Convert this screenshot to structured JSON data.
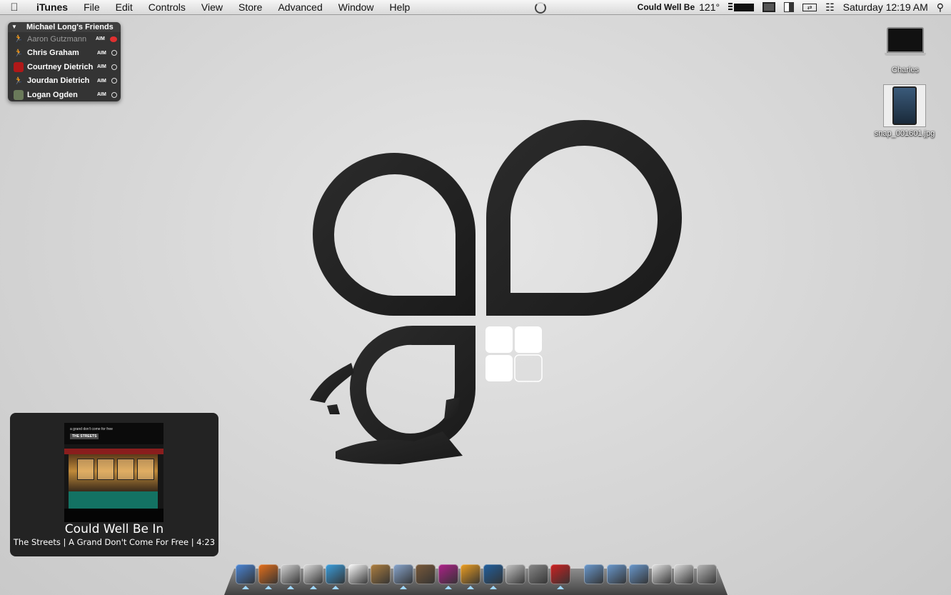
{
  "menubar": {
    "app": "iTunes",
    "menus": [
      "File",
      "Edit",
      "Controls",
      "View",
      "Store",
      "Advanced",
      "Window",
      "Help"
    ],
    "now_playing": "Could Well Be",
    "temperature": "121°",
    "clock": "Saturday 12:19 AM"
  },
  "buddy_list": {
    "title": "Michael Long's Friends",
    "buddies": [
      {
        "name": "Aaron Gutzmann",
        "service": "AIM",
        "status": "away"
      },
      {
        "name": "Chris Graham",
        "service": "AIM",
        "status": "available"
      },
      {
        "name": "Courtney Dietrich",
        "service": "AIM",
        "status": "available"
      },
      {
        "name": "Jourdan Dietrich",
        "service": "AIM",
        "status": "available"
      },
      {
        "name": "Logan Ogden",
        "service": "AIM",
        "status": "available"
      }
    ]
  },
  "desktop": {
    "icons": [
      {
        "label": "Charles",
        "kind": "laptop-icon"
      },
      {
        "label": "snap_001601.jpg",
        "kind": "image-file-icon"
      }
    ]
  },
  "growl": {
    "title": "Could Well Be In",
    "detail": "The Streets | A Grand Don't Come For Free | 4:23",
    "album_art": {
      "top_text": "a grand don't come for free",
      "artist_tag": "THE STREETS"
    }
  },
  "dock": {
    "apps": [
      {
        "name": "finder-icon",
        "running": true,
        "color": "#4a86d8"
      },
      {
        "name": "firefox-icon",
        "running": true,
        "color": "#e8701a"
      },
      {
        "name": "mail-icon",
        "running": true,
        "color": "#d8d8d8"
      },
      {
        "name": "ichat-icon",
        "running": true,
        "color": "#e0e0e0"
      },
      {
        "name": "itunes-icon",
        "running": true,
        "color": "#3aa0e0"
      },
      {
        "name": "ical-icon",
        "running": false,
        "color": "#ffffff"
      },
      {
        "name": "address-book-icon",
        "running": false,
        "color": "#b08040"
      },
      {
        "name": "preview-icon",
        "running": true,
        "color": "#8aa8d0"
      },
      {
        "name": "iphoto-icon",
        "running": false,
        "color": "#7a5a3a"
      },
      {
        "name": "indesign-icon",
        "running": true,
        "color": "#b0208a"
      },
      {
        "name": "illustrator-icon",
        "running": true,
        "color": "#f0a020"
      },
      {
        "name": "photoshop-icon",
        "running": true,
        "color": "#2060a0"
      },
      {
        "name": "textedit-icon",
        "running": false,
        "color": "#c8c8c8"
      },
      {
        "name": "system-preferences-icon",
        "running": false,
        "color": "#8a8a8a"
      },
      {
        "name": "red-app-icon",
        "running": true,
        "color": "#d02020"
      },
      {
        "name": "separator",
        "running": false,
        "color": "transparent"
      },
      {
        "name": "globe-folder-icon",
        "running": false,
        "color": "#6a9ad0"
      },
      {
        "name": "applications-folder-icon",
        "running": false,
        "color": "#6a9ad0"
      },
      {
        "name": "documents-folder-icon",
        "running": false,
        "color": "#6a9ad0"
      },
      {
        "name": "stack-icon",
        "running": false,
        "color": "#e8e8e8"
      },
      {
        "name": "downloads-stack-icon",
        "running": false,
        "color": "#e0e0e0"
      },
      {
        "name": "trash-icon",
        "running": false,
        "color": "#bcbcbc"
      }
    ]
  }
}
